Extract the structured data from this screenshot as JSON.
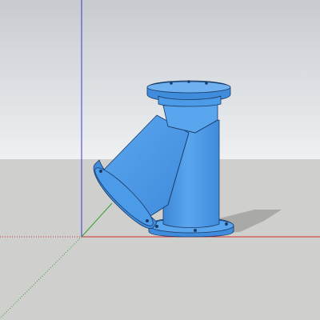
{
  "app": {
    "view": "perspective-3d-viewport",
    "model": "y-strainer-pipe-fitting"
  },
  "colors": {
    "sky_top": "#c9cdd2",
    "sky_bottom": "#eceef0",
    "ground": "#cfcfcd",
    "model_blue": "#4c9be8",
    "model_blue_dark": "#2e78c8",
    "model_blue_light": "#6fb1f0",
    "edge": "#1a3a66",
    "axis_red": "#d23030",
    "axis_green": "#2da02d",
    "axis_blue": "#3a3ad0",
    "shadow": "#a9a9a7"
  }
}
